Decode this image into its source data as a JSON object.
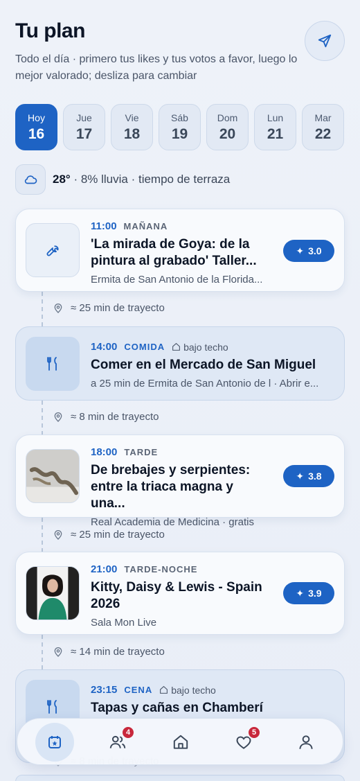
{
  "header": {
    "title": "Tu plan",
    "subtitle": "Todo el día · primero tus likes y tus votos a favor, luego lo mejor valorado; desliza para cambiar"
  },
  "days": [
    {
      "name": "Hoy",
      "num": "16",
      "active": true
    },
    {
      "name": "Jue",
      "num": "17"
    },
    {
      "name": "Vie",
      "num": "18"
    },
    {
      "name": "Sáb",
      "num": "19"
    },
    {
      "name": "Dom",
      "num": "20"
    },
    {
      "name": "Lun",
      "num": "21"
    },
    {
      "name": "Mar",
      "num": "22"
    }
  ],
  "weather": {
    "temp": "28°",
    "rest": " · 8% lluvia · tiempo de terraza",
    "icon": "cloud-icon"
  },
  "items": [
    {
      "time": "11:00",
      "period": "MAÑANA",
      "title": "'La mirada de Goya: de la pintura al grabado' Taller...",
      "sub": "Ermita de San Antonio de la Florida...",
      "score": "3.0",
      "icon": "wrench-icon"
    },
    {
      "time": "14:00",
      "period": "COMIDA",
      "indoor": "bajo techo",
      "title": "Comer en el Mercado de San Miguel",
      "sub": "a 25 min de Ermita de San Antonio de l · Abrir e...",
      "icon": "fork-knife-icon"
    },
    {
      "time": "18:00",
      "period": "TARDE",
      "title": "De brebajes y serpientes: entre la triaca magna y una...",
      "sub": "Real Academia de Medicina · gratis",
      "score": "3.8",
      "image": "serpent-sculpture-photo"
    },
    {
      "time": "21:00",
      "period": "TARDE-NOCHE",
      "title": "Kitty, Daisy & Lewis - Spain 2026",
      "sub": "Sala Mon Live",
      "score": "3.9",
      "image": "band-photo"
    },
    {
      "time": "23:15",
      "period": "CENA",
      "indoor": "bajo techo",
      "title": "Tapas y cañas en Chamberí",
      "icon": "fork-knife-icon"
    }
  ],
  "travel": [
    "≈ 25 min de trayecto",
    "≈ 8 min de trayecto",
    "≈ 25 min de trayecto",
    "≈ 14 min de trayecto",
    "≈ 8 min de trayecto"
  ],
  "tabbar": {
    "badges": {
      "friends": "4",
      "likes": "5"
    }
  },
  "colors": {
    "accent": "#1e63c4",
    "badge": "#c8283c",
    "background": "#eef2f9"
  }
}
